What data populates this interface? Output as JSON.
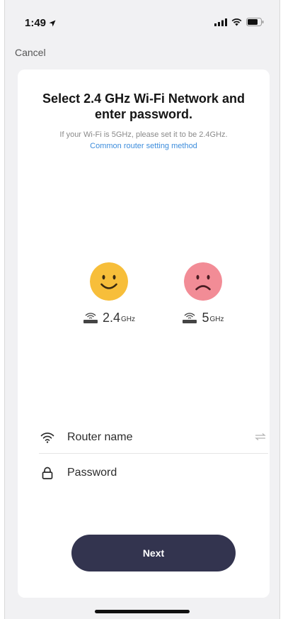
{
  "status_bar": {
    "time": "1:49"
  },
  "nav": {
    "cancel_label": "Cancel"
  },
  "card": {
    "title": "Select 2.4 GHz Wi-Fi Network and enter password.",
    "hint": "If your Wi-Fi is 5GHz, please set it to be 2.4GHz.",
    "link": "Common router setting method"
  },
  "bands": [
    {
      "number": "2.4",
      "unit": "GHz",
      "face": "smile",
      "color": "#f7be3a"
    },
    {
      "number": "5",
      "unit": "GHz",
      "face": "frown",
      "color": "#f28c96"
    }
  ],
  "form": {
    "router_placeholder": "Router name",
    "password_placeholder": "Password"
  },
  "actions": {
    "next_label": "Next"
  },
  "colors": {
    "button": "#33344f",
    "link": "#3d8ddc"
  }
}
